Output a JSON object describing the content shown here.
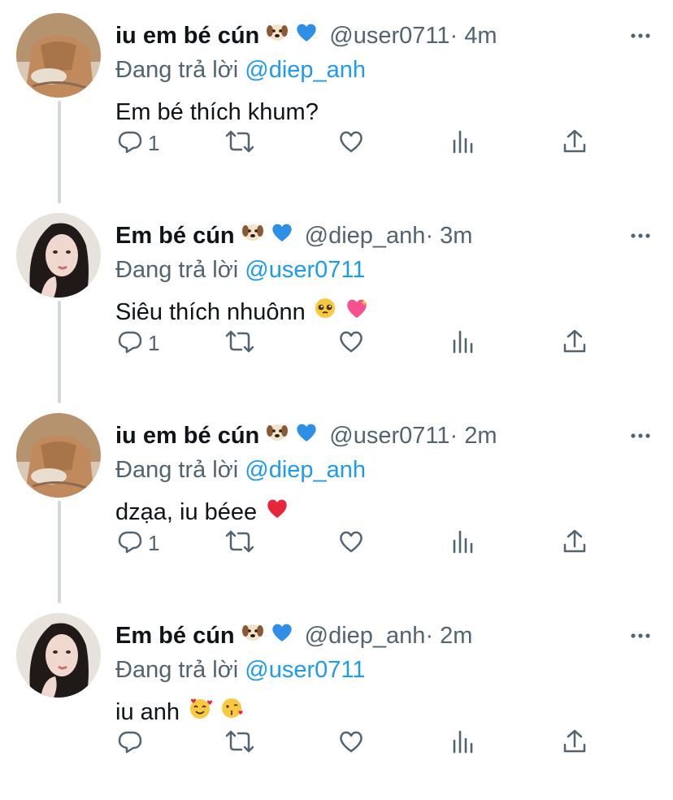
{
  "tweets": [
    {
      "author_name": "iu em bé cún",
      "handle": "@user0711",
      "time": " · 4m",
      "replying_prefix": "Đang trả lời ",
      "replying_to": "@diep_anh",
      "text": "Em bé thích khum?",
      "reply_count": "1",
      "avatar": "man-avatar",
      "text_emojis": []
    },
    {
      "author_name": "Em bé cún",
      "handle": "@diep_anh",
      "time": " · 3m",
      "replying_prefix": "Đang trả lời ",
      "replying_to": "@user0711",
      "text": "Siêu thích nhuônn",
      "reply_count": "1",
      "avatar": "woman-avatar",
      "text_emojis": [
        "pleading-face-emoji",
        "sparkling-heart-emoji"
      ]
    },
    {
      "author_name": "iu em bé cún",
      "handle": "@user0711",
      "time": " · 2m",
      "replying_prefix": "Đang trả lời ",
      "replying_to": "@diep_anh",
      "text": "dzạa, iu béee",
      "reply_count": "1",
      "avatar": "man-avatar",
      "text_emojis": [
        "red-heart-emoji"
      ]
    },
    {
      "author_name": "Em bé cún",
      "handle": "@diep_anh",
      "time": " · 2m",
      "replying_prefix": "Đang trả lời ",
      "replying_to": "@user0711",
      "text": "iu anh",
      "reply_count": "",
      "avatar": "woman-avatar",
      "text_emojis": [
        "smiling-face-with-hearts-emoji",
        "face-blowing-kiss-emoji"
      ]
    }
  ],
  "name_emojis": [
    "dog-face-emoji",
    "blue-heart-emoji"
  ],
  "icons": [
    "reply-icon",
    "retweet-icon",
    "like-icon",
    "analytics-icon",
    "share-icon",
    "more-icon"
  ],
  "colors": {
    "text": "#0f1419",
    "secondary": "#536471",
    "link": "#1d9bf0",
    "thread_line": "#cfd9de"
  }
}
